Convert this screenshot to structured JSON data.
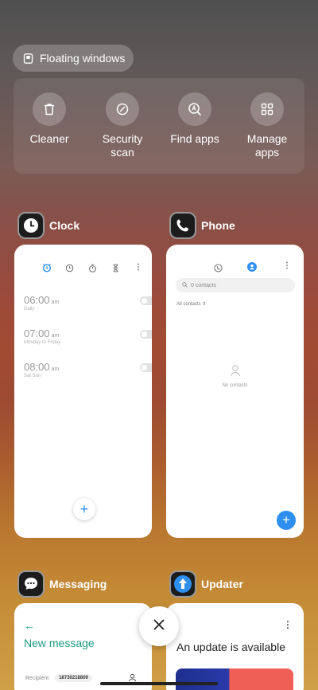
{
  "floating_windows": {
    "label": "Floating windows",
    "icon": "floating-window-icon"
  },
  "tools": [
    {
      "label": "Cleaner",
      "icon": "trash-icon"
    },
    {
      "label": "Security scan",
      "icon": "security-scan-icon"
    },
    {
      "label": "Find apps",
      "icon": "find-apps-icon"
    },
    {
      "label": "Manage apps",
      "icon": "grid-icon"
    }
  ],
  "apps": {
    "clock": {
      "name": "Clock",
      "alarms": [
        {
          "time": "06:00",
          "ampm": "am",
          "repeat": "Daily"
        },
        {
          "time": "07:00",
          "ampm": "am",
          "repeat": "Monday to Friday"
        },
        {
          "time": "08:00",
          "ampm": "am",
          "repeat": "Sat Sun"
        }
      ]
    },
    "phone": {
      "name": "Phone",
      "search_placeholder": "0 contacts",
      "filter": "All contacts",
      "empty_text": "No contacts"
    },
    "messaging": {
      "name": "Messaging",
      "back_icon": "←",
      "title": "New message",
      "recipient_label": "Recipient",
      "recipient_value": "18730218809"
    },
    "updater": {
      "name": "Updater",
      "title": "An update is available"
    }
  },
  "colors": {
    "accent_blue": "#2e8ff0",
    "messaging_green": "#1a9a7f"
  }
}
